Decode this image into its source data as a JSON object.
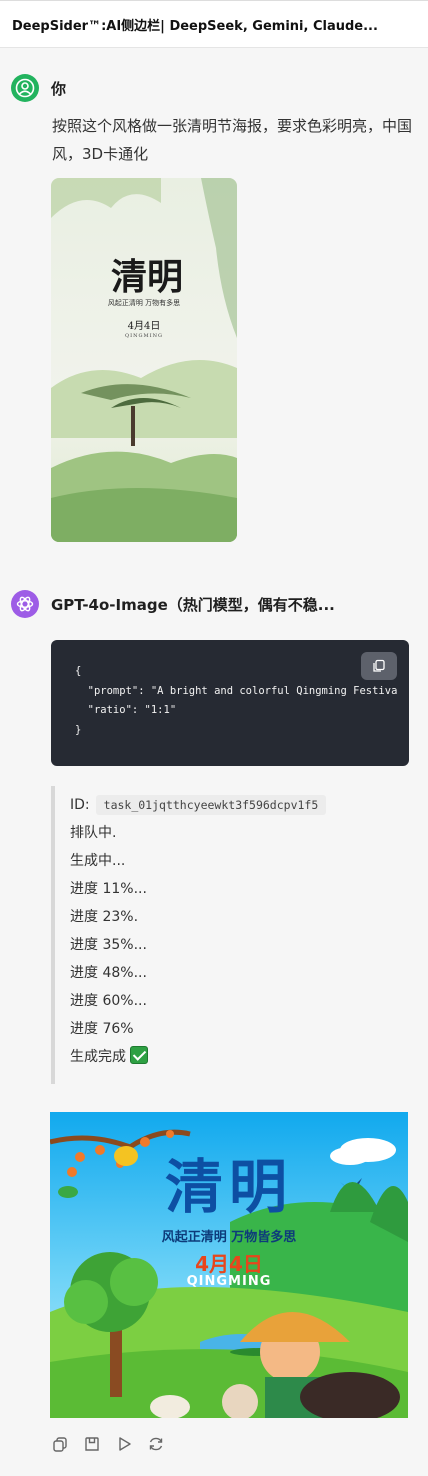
{
  "header": {
    "title": "DeepSider™:AI侧边栏| DeepSeek, Gemini, Claude..."
  },
  "user_message": {
    "sender": "你",
    "text": "按照这个风格做一张清明节海报，要求色彩明亮，中国风，3D卡通化",
    "attachment": {
      "title": "清明",
      "subtitle": "风起正清明 万物有多思",
      "date": "4月4日",
      "romanization": "QINGMING"
    }
  },
  "bot_message": {
    "sender": "GPT-4o-Image（热门模型，偶有不稳...",
    "code": {
      "lines": [
        "{",
        "  \"prompt\": \"A bright and colorful Qingming Festiva",
        "  \"ratio\": \"1:1\"",
        "}"
      ]
    },
    "task": {
      "id_label": "ID:",
      "id": "task_01jqtthcyeewkt3f596dcpv1f5",
      "statuses": [
        "排队中.",
        "生成中...",
        "进度 11%...",
        "进度 23%.",
        "进度 35%...",
        "进度 48%...",
        "进度 60%...",
        "进度 76%"
      ],
      "done": "生成完成"
    },
    "poster": {
      "title": "清明",
      "subtitle": "风起正清明 万物皆多思",
      "date": "4月4日",
      "romanization": "QINGMING"
    },
    "actions": [
      "copy-icon",
      "save-icon",
      "play-icon",
      "regenerate-icon"
    ]
  },
  "colors": {
    "user_avatar": "#22b35e",
    "bot_avatar": "#9d5ce6",
    "code_bg": "#262a33",
    "poster_sky": "#1fb6f0",
    "poster_title": "#0d4fa3",
    "poster_date": "#e8461c"
  }
}
